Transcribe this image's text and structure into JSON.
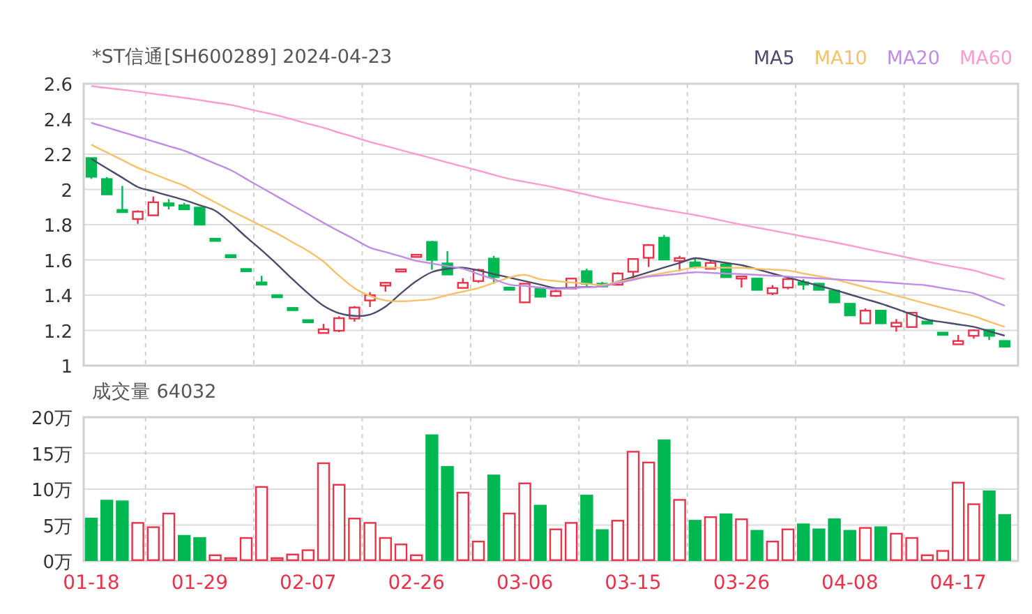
{
  "title": "*ST信通[SH600289] 2024-04-23",
  "price_chart": {
    "candles": {
      "chart_data": {
        "type": "candlestick",
        "grid": true,
        "ylim": [
          1,
          2.6
        ],
        "yticks": [
          {
            "value": 2.6,
            "label": "2.6"
          },
          {
            "value": 2.4,
            "label": "2.4"
          },
          {
            "value": 2.2,
            "label": "2.2"
          },
          {
            "value": 2,
            "label": "2"
          },
          {
            "value": 1.8,
            "label": "1.8"
          },
          {
            "value": 1.6,
            "label": "1.6"
          },
          {
            "value": 1.4,
            "label": "1.4"
          },
          {
            "value": 1.2,
            "label": "1.2"
          },
          {
            "value": 1,
            "label": "1"
          }
        ],
        "ohlc": [
          [
            2.178,
            2.18,
            2.06,
            2.072
          ],
          [
            2.059,
            2.07,
            1.97,
            1.972
          ],
          [
            1.884,
            2.02,
            1.87,
            1.871
          ],
          [
            1.832,
            1.882,
            1.805,
            1.874
          ],
          [
            1.853,
            1.96,
            1.85,
            1.927
          ],
          [
            1.92,
            1.945,
            1.887,
            1.91
          ],
          [
            1.91,
            1.924,
            1.887,
            1.887
          ],
          [
            1.897,
            1.9,
            1.8,
            1.8
          ],
          [
            1.715,
            1.715,
            1.713,
            1.713
          ],
          [
            1.622,
            1.622,
            1.62,
            1.62
          ],
          [
            1.543,
            1.543,
            1.541,
            1.541
          ],
          [
            1.467,
            1.51,
            1.465,
            1.465
          ],
          [
            1.395,
            1.395,
            1.393,
            1.393
          ],
          [
            1.322,
            1.322,
            1.32,
            1.32
          ],
          [
            1.253,
            1.253,
            1.251,
            1.251
          ],
          [
            1.185,
            1.237,
            1.185,
            1.206
          ],
          [
            1.198,
            1.28,
            1.19,
            1.269
          ],
          [
            1.267,
            1.338,
            1.25,
            1.33
          ],
          [
            1.37,
            1.417,
            1.333,
            1.4
          ],
          [
            1.454,
            1.475,
            1.42,
            1.47
          ],
          [
            1.54,
            1.54,
            1.54,
            1.54
          ],
          [
            1.623,
            1.623,
            1.623,
            1.623
          ],
          [
            1.702,
            1.708,
            1.544,
            1.6
          ],
          [
            1.58,
            1.65,
            1.517,
            1.517
          ],
          [
            1.441,
            1.496,
            1.441,
            1.47
          ],
          [
            1.48,
            1.55,
            1.47,
            1.543
          ],
          [
            1.607,
            1.623,
            1.465,
            1.502
          ],
          [
            1.44,
            1.44,
            1.43,
            1.433
          ],
          [
            1.359,
            1.465,
            1.359,
            1.465
          ],
          [
            1.436,
            1.449,
            1.391,
            1.391
          ],
          [
            1.396,
            1.43,
            1.39,
            1.422
          ],
          [
            1.438,
            1.494,
            1.438,
            1.494
          ],
          [
            1.536,
            1.55,
            1.45,
            1.465
          ],
          [
            1.465,
            1.475,
            1.445,
            1.449
          ],
          [
            1.459,
            1.53,
            1.455,
            1.523
          ],
          [
            1.533,
            1.61,
            1.483,
            1.605
          ],
          [
            1.612,
            1.69,
            1.56,
            1.684
          ],
          [
            1.726,
            1.742,
            1.6,
            1.602
          ],
          [
            1.594,
            1.623,
            1.536,
            1.61
          ],
          [
            1.586,
            1.607,
            1.55,
            1.56
          ],
          [
            1.55,
            1.6,
            1.55,
            1.583
          ],
          [
            1.575,
            1.58,
            1.5,
            1.502
          ],
          [
            1.496,
            1.504,
            1.443,
            1.504
          ],
          [
            1.494,
            1.494,
            1.43,
            1.43
          ],
          [
            1.41,
            1.457,
            1.4,
            1.44
          ],
          [
            1.443,
            1.499,
            1.433,
            1.491
          ],
          [
            1.47,
            1.49,
            1.43,
            1.462
          ],
          [
            1.465,
            1.47,
            1.43,
            1.43
          ],
          [
            1.425,
            1.43,
            1.355,
            1.359
          ],
          [
            1.351,
            1.351,
            1.285,
            1.285
          ],
          [
            1.24,
            1.325,
            1.24,
            1.312
          ],
          [
            1.312,
            1.312,
            1.24,
            1.24
          ],
          [
            1.222,
            1.264,
            1.193,
            1.243
          ],
          [
            1.219,
            1.3,
            1.219,
            1.3
          ],
          [
            1.245,
            1.245,
            1.243,
            1.243
          ],
          [
            1.182,
            1.182,
            1.18,
            1.18
          ],
          [
            1.121,
            1.174,
            1.121,
            1.14
          ],
          [
            1.169,
            1.206,
            1.153,
            1.2
          ],
          [
            1.203,
            1.206,
            1.145,
            1.169
          ],
          [
            1.14,
            1.14,
            1.105,
            1.108
          ]
        ]
      }
    },
    "moving_averages": {
      "chart_data": {
        "type": "line",
        "ylim": [
          1,
          2.6
        ],
        "series": [
          {
            "name": "MA5",
            "color": "#4b4b6b",
            "values": [
              2.173,
              2.12,
              2.067,
              2.014,
              1.989,
              1.965,
              1.94,
              1.91,
              1.879,
              1.81,
              1.73,
              1.655,
              1.575,
              1.49,
              1.41,
              1.34,
              1.298,
              1.282,
              1.29,
              1.335,
              1.41,
              1.48,
              1.531,
              1.55,
              1.556,
              1.54,
              1.52,
              1.5,
              1.48,
              1.46,
              1.44,
              1.443,
              1.447,
              1.45,
              1.477,
              1.503,
              1.53,
              1.557,
              1.583,
              1.61,
              1.597,
              1.583,
              1.57,
              1.547,
              1.523,
              1.5,
              1.477,
              1.453,
              1.43,
              1.404,
              1.378,
              1.352,
              1.322,
              1.291,
              1.261,
              1.247,
              1.234,
              1.22,
              1.195,
              1.17
            ]
          },
          {
            "name": "MA10",
            "color": "#f7c06a",
            "values": [
              2.254,
              2.21,
              2.167,
              2.123,
              2.089,
              2.054,
              2.02,
              1.973,
              1.927,
              1.88,
              1.837,
              1.793,
              1.75,
              1.7,
              1.65,
              1.59,
              1.51,
              1.44,
              1.395,
              1.37,
              1.365,
              1.37,
              1.378,
              1.4,
              1.42,
              1.44,
              1.47,
              1.5,
              1.515,
              1.49,
              1.48,
              1.472,
              1.465,
              1.457,
              1.475,
              1.492,
              1.51,
              1.526,
              1.541,
              1.557,
              1.556,
              1.556,
              1.555,
              1.55,
              1.545,
              1.54,
              1.523,
              1.507,
              1.49,
              1.467,
              1.444,
              1.421,
              1.397,
              1.374,
              1.35,
              1.327,
              1.303,
              1.28,
              1.25,
              1.22
            ]
          },
          {
            "name": "MA20",
            "color": "#c08de6",
            "values": [
              2.378,
              2.352,
              2.325,
              2.299,
              2.273,
              2.246,
              2.22,
              2.183,
              2.147,
              2.11,
              2.06,
              2.01,
              1.96,
              1.91,
              1.86,
              1.81,
              1.763,
              1.717,
              1.67,
              1.645,
              1.62,
              1.595,
              1.58,
              1.565,
              1.55,
              1.52,
              1.49,
              1.46,
              1.452,
              1.443,
              1.435,
              1.44,
              1.445,
              1.45,
              1.468,
              1.487,
              1.505,
              1.513,
              1.522,
              1.53,
              1.527,
              1.523,
              1.52,
              1.515,
              1.51,
              1.505,
              1.5,
              1.495,
              1.49,
              1.485,
              1.48,
              1.475,
              1.468,
              1.462,
              1.455,
              1.44,
              1.425,
              1.41,
              1.375,
              1.34
            ]
          },
          {
            "name": "MA60",
            "color": "#fb9ccb",
            "values": [
              2.587,
              2.576,
              2.566,
              2.555,
              2.543,
              2.532,
              2.52,
              2.507,
              2.493,
              2.48,
              2.46,
              2.44,
              2.42,
              2.397,
              2.373,
              2.35,
              2.323,
              2.297,
              2.27,
              2.247,
              2.223,
              2.2,
              2.177,
              2.153,
              2.13,
              2.107,
              2.083,
              2.06,
              2.043,
              2.027,
              2.01,
              1.99,
              1.97,
              1.95,
              1.933,
              1.917,
              1.9,
              1.885,
              1.87,
              1.855,
              1.837,
              1.818,
              1.8,
              1.783,
              1.767,
              1.75,
              1.733,
              1.717,
              1.7,
              1.682,
              1.663,
              1.645,
              1.627,
              1.608,
              1.59,
              1.573,
              1.557,
              1.54,
              1.515,
              1.49
            ]
          }
        ]
      }
    }
  },
  "volume_chart": {
    "label": "成交量 64032",
    "chart_data": {
      "type": "bar",
      "grid": true,
      "categories": [
        "01-18",
        null,
        null,
        null,
        null,
        null,
        null,
        "01-29",
        null,
        null,
        null,
        null,
        null,
        null,
        "02-07",
        null,
        null,
        null,
        null,
        null,
        null,
        "02-26",
        null,
        null,
        null,
        null,
        null,
        null,
        "03-06",
        null,
        null,
        null,
        null,
        null,
        null,
        "03-15",
        null,
        null,
        null,
        null,
        null,
        null,
        "03-26",
        null,
        null,
        null,
        null,
        null,
        null,
        "04-08",
        null,
        null,
        null,
        null,
        null,
        null,
        "04-17",
        null,
        null,
        null
      ],
      "series": [
        {
          "color": "#e8334a",
          "values": [
            null,
            null,
            null,
            5.3,
            4.7,
            6.6,
            null,
            null,
            0.8,
            0.4,
            3.2,
            10.3,
            0.4,
            0.9,
            1.5,
            13.6,
            10.6,
            5.9,
            5.3,
            3.2,
            2.3,
            0.8,
            null,
            null,
            9.5,
            2.7,
            null,
            6.6,
            10.8,
            null,
            4.4,
            5.3,
            null,
            null,
            5.6,
            15.2,
            13.7,
            null,
            8.5,
            null,
            6.1,
            null,
            5.8,
            null,
            2.7,
            4.4,
            null,
            null,
            null,
            null,
            4.6,
            null,
            3.8,
            3.2,
            0.8,
            1.4,
            10.9,
            7.9,
            null,
            null
          ]
        },
        {
          "color": "#00b852",
          "values": [
            5.9,
            8.4,
            8.3,
            null,
            null,
            null,
            3.5,
            3.2,
            null,
            null,
            null,
            null,
            null,
            null,
            null,
            null,
            null,
            null,
            null,
            null,
            null,
            null,
            17.5,
            13.1,
            null,
            null,
            11.9,
            null,
            null,
            7.7,
            null,
            null,
            9.1,
            4.3,
            null,
            null,
            null,
            16.8,
            null,
            5.6,
            null,
            6.5,
            null,
            4.2,
            null,
            null,
            5.1,
            4.4,
            5.8,
            4.2,
            null,
            4.7,
            null,
            null,
            null,
            null,
            null,
            null,
            9.7,
            6.4
          ]
        }
      ],
      "ylim": [
        0,
        20
      ],
      "yticks": [
        {
          "value": 20,
          "label": "20万"
        },
        {
          "value": 15,
          "label": "15万"
        },
        {
          "value": 10,
          "label": "10万"
        },
        {
          "value": 5,
          "label": "5万"
        },
        {
          "value": 0,
          "label": "0万"
        }
      ]
    }
  }
}
